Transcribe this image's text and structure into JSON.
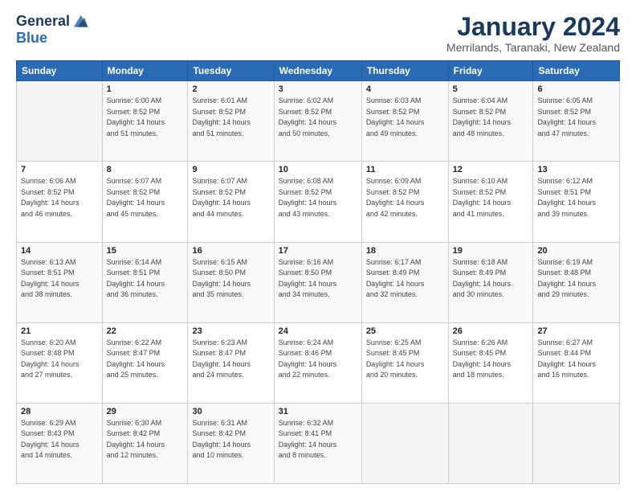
{
  "logo": {
    "line1": "General",
    "line2": "Blue"
  },
  "header": {
    "title": "January 2024",
    "location": "Merrilands, Taranaki, New Zealand"
  },
  "days_of_week": [
    "Sunday",
    "Monday",
    "Tuesday",
    "Wednesday",
    "Thursday",
    "Friday",
    "Saturday"
  ],
  "weeks": [
    [
      {
        "day": "",
        "sunrise": "",
        "sunset": "",
        "daylight": ""
      },
      {
        "day": "1",
        "sunrise": "Sunrise: 6:00 AM",
        "sunset": "Sunset: 8:52 PM",
        "daylight": "Daylight: 14 hours and 51 minutes."
      },
      {
        "day": "2",
        "sunrise": "Sunrise: 6:01 AM",
        "sunset": "Sunset: 8:52 PM",
        "daylight": "Daylight: 14 hours and 51 minutes."
      },
      {
        "day": "3",
        "sunrise": "Sunrise: 6:02 AM",
        "sunset": "Sunset: 8:52 PM",
        "daylight": "Daylight: 14 hours and 50 minutes."
      },
      {
        "day": "4",
        "sunrise": "Sunrise: 6:03 AM",
        "sunset": "Sunset: 8:52 PM",
        "daylight": "Daylight: 14 hours and 49 minutes."
      },
      {
        "day": "5",
        "sunrise": "Sunrise: 6:04 AM",
        "sunset": "Sunset: 8:52 PM",
        "daylight": "Daylight: 14 hours and 48 minutes."
      },
      {
        "day": "6",
        "sunrise": "Sunrise: 6:05 AM",
        "sunset": "Sunset: 8:52 PM",
        "daylight": "Daylight: 14 hours and 47 minutes."
      }
    ],
    [
      {
        "day": "7",
        "sunrise": "Sunrise: 6:06 AM",
        "sunset": "Sunset: 8:52 PM",
        "daylight": "Daylight: 14 hours and 46 minutes."
      },
      {
        "day": "8",
        "sunrise": "Sunrise: 6:07 AM",
        "sunset": "Sunset: 8:52 PM",
        "daylight": "Daylight: 14 hours and 45 minutes."
      },
      {
        "day": "9",
        "sunrise": "Sunrise: 6:07 AM",
        "sunset": "Sunset: 8:52 PM",
        "daylight": "Daylight: 14 hours and 44 minutes."
      },
      {
        "day": "10",
        "sunrise": "Sunrise: 6:08 AM",
        "sunset": "Sunset: 8:52 PM",
        "daylight": "Daylight: 14 hours and 43 minutes."
      },
      {
        "day": "11",
        "sunrise": "Sunrise: 6:09 AM",
        "sunset": "Sunset: 8:52 PM",
        "daylight": "Daylight: 14 hours and 42 minutes."
      },
      {
        "day": "12",
        "sunrise": "Sunrise: 6:10 AM",
        "sunset": "Sunset: 8:52 PM",
        "daylight": "Daylight: 14 hours and 41 minutes."
      },
      {
        "day": "13",
        "sunrise": "Sunrise: 6:12 AM",
        "sunset": "Sunset: 8:51 PM",
        "daylight": "Daylight: 14 hours and 39 minutes."
      }
    ],
    [
      {
        "day": "14",
        "sunrise": "Sunrise: 6:13 AM",
        "sunset": "Sunset: 8:51 PM",
        "daylight": "Daylight: 14 hours and 38 minutes."
      },
      {
        "day": "15",
        "sunrise": "Sunrise: 6:14 AM",
        "sunset": "Sunset: 8:51 PM",
        "daylight": "Daylight: 14 hours and 36 minutes."
      },
      {
        "day": "16",
        "sunrise": "Sunrise: 6:15 AM",
        "sunset": "Sunset: 8:50 PM",
        "daylight": "Daylight: 14 hours and 35 minutes."
      },
      {
        "day": "17",
        "sunrise": "Sunrise: 6:16 AM",
        "sunset": "Sunset: 8:50 PM",
        "daylight": "Daylight: 14 hours and 34 minutes."
      },
      {
        "day": "18",
        "sunrise": "Sunrise: 6:17 AM",
        "sunset": "Sunset: 8:49 PM",
        "daylight": "Daylight: 14 hours and 32 minutes."
      },
      {
        "day": "19",
        "sunrise": "Sunrise: 6:18 AM",
        "sunset": "Sunset: 8:49 PM",
        "daylight": "Daylight: 14 hours and 30 minutes."
      },
      {
        "day": "20",
        "sunrise": "Sunrise: 6:19 AM",
        "sunset": "Sunset: 8:48 PM",
        "daylight": "Daylight: 14 hours and 29 minutes."
      }
    ],
    [
      {
        "day": "21",
        "sunrise": "Sunrise: 6:20 AM",
        "sunset": "Sunset: 8:48 PM",
        "daylight": "Daylight: 14 hours and 27 minutes."
      },
      {
        "day": "22",
        "sunrise": "Sunrise: 6:22 AM",
        "sunset": "Sunset: 8:47 PM",
        "daylight": "Daylight: 14 hours and 25 minutes."
      },
      {
        "day": "23",
        "sunrise": "Sunrise: 6:23 AM",
        "sunset": "Sunset: 8:47 PM",
        "daylight": "Daylight: 14 hours and 24 minutes."
      },
      {
        "day": "24",
        "sunrise": "Sunrise: 6:24 AM",
        "sunset": "Sunset: 8:46 PM",
        "daylight": "Daylight: 14 hours and 22 minutes."
      },
      {
        "day": "25",
        "sunrise": "Sunrise: 6:25 AM",
        "sunset": "Sunset: 8:45 PM",
        "daylight": "Daylight: 14 hours and 20 minutes."
      },
      {
        "day": "26",
        "sunrise": "Sunrise: 6:26 AM",
        "sunset": "Sunset: 8:45 PM",
        "daylight": "Daylight: 14 hours and 18 minutes."
      },
      {
        "day": "27",
        "sunrise": "Sunrise: 6:27 AM",
        "sunset": "Sunset: 8:44 PM",
        "daylight": "Daylight: 14 hours and 16 minutes."
      }
    ],
    [
      {
        "day": "28",
        "sunrise": "Sunrise: 6:29 AM",
        "sunset": "Sunset: 8:43 PM",
        "daylight": "Daylight: 14 hours and 14 minutes."
      },
      {
        "day": "29",
        "sunrise": "Sunrise: 6:30 AM",
        "sunset": "Sunset: 8:42 PM",
        "daylight": "Daylight: 14 hours and 12 minutes."
      },
      {
        "day": "30",
        "sunrise": "Sunrise: 6:31 AM",
        "sunset": "Sunset: 8:42 PM",
        "daylight": "Daylight: 14 hours and 10 minutes."
      },
      {
        "day": "31",
        "sunrise": "Sunrise: 6:32 AM",
        "sunset": "Sunset: 8:41 PM",
        "daylight": "Daylight: 14 hours and 8 minutes."
      },
      {
        "day": "",
        "sunrise": "",
        "sunset": "",
        "daylight": ""
      },
      {
        "day": "",
        "sunrise": "",
        "sunset": "",
        "daylight": ""
      },
      {
        "day": "",
        "sunrise": "",
        "sunset": "",
        "daylight": ""
      }
    ]
  ]
}
